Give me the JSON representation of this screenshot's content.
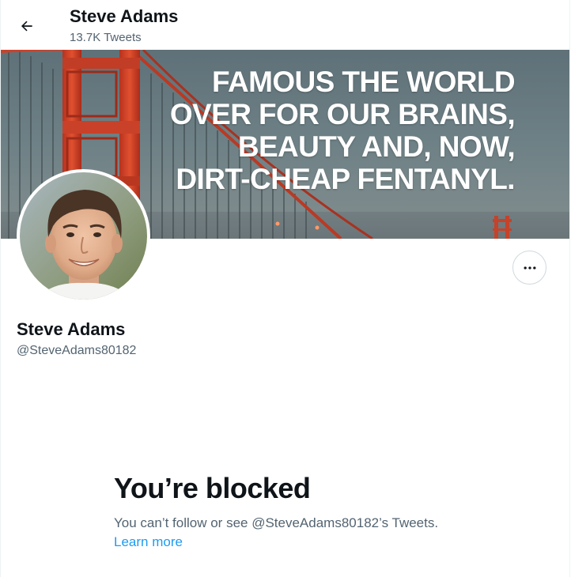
{
  "header": {
    "name": "Steve Adams",
    "tweet_count": "13.7K Tweets",
    "back_icon": "arrow-left-icon"
  },
  "banner": {
    "lines": [
      "FAMOUS THE WORLD",
      "OVER FOR OUR BRAINS,",
      "BEAUTY AND, NOW,",
      "DIRT-CHEAP FENTANYL."
    ],
    "text_color": "#ffffff",
    "bridge_color": "#d9432b"
  },
  "profile": {
    "name": "Steve Adams",
    "handle": "@SteveAdams80182",
    "more_icon": "more-horizontal-icon"
  },
  "blocked": {
    "title": "You’re blocked",
    "body_prefix": "You can’t follow or see @SteveAdams80182’s Tweets.",
    "learn_more": "Learn more"
  },
  "colors": {
    "primary_text": "#0f1419",
    "secondary_text": "#536471",
    "link": "#1d9bf0",
    "border": "#cfd9de"
  }
}
